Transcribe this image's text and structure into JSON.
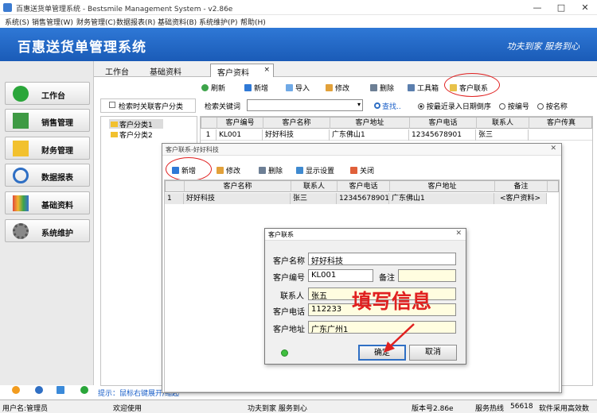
{
  "window": {
    "title": "百惠送货单管理系统 - Bestsmile Management System - v2.86e",
    "minimize": "—",
    "maximize": "□",
    "close": "✕"
  },
  "menu": [
    "系统(S)",
    "销售管理(W)",
    "财务管理(C)",
    "数据报表(R)",
    "基础资料(B)",
    "系统维护(P)",
    "帮助(H)"
  ],
  "banner": {
    "name": "百惠送货单管理系统",
    "slogan": "功夫到家 服务到心"
  },
  "sidebar": [
    "工作台",
    "销售管理",
    "财务管理",
    "数据报表",
    "基础资料",
    "系统维护"
  ],
  "tabs": [
    "工作台",
    "基础资料",
    "客户资料"
  ],
  "tab_close": "×",
  "toolbar": [
    "刷新",
    "新增",
    "导入",
    "修改",
    "删除",
    "工具箱",
    "客户联系"
  ],
  "filter": {
    "checkbox": "检索时关联客户分类",
    "keyword_label": "检索关键词",
    "search": "查找..",
    "sort1": "按最近录入日期倒序",
    "sort2": "按编号",
    "sort3": "按名称"
  },
  "tree": [
    "客户分类1",
    "客户分类2"
  ],
  "customer_table": {
    "headers": [
      "客户编号",
      "客户名称",
      "客户地址",
      "客户电话",
      "联系人",
      "客户传真"
    ],
    "rows": [
      {
        "n": "1",
        "cells": [
          "KL001",
          "好好科技",
          "广东佛山1",
          "12345678901",
          "张三",
          ""
        ]
      }
    ]
  },
  "contact_dialog": {
    "title": "客户联系-好好科技",
    "close": "✕",
    "toolbar": [
      "新增",
      "修改",
      "删除",
      "显示设置",
      "关闭"
    ],
    "headers": [
      "客户名称",
      "联系人",
      "客户电话",
      "客户地址",
      "备注"
    ],
    "rows": [
      {
        "n": "1",
        "cells": [
          "好好科技",
          "张三",
          "12345678901",
          "广东佛山1",
          "<客户资料>"
        ]
      }
    ]
  },
  "form_dialog": {
    "title": "客户联系",
    "close": "✕",
    "labels": {
      "name": "客户名称",
      "code": "客户编号",
      "remark": "备注",
      "contact": "联系人",
      "phone": "客户电话",
      "address": "客户地址"
    },
    "values": {
      "name": "好好科技",
      "code": "KL001",
      "remark": "",
      "contact": "张五",
      "phone": "112233",
      "address": "广东广州1"
    },
    "ok": "确定",
    "cancel": "取消"
  },
  "annotation": "填写信息",
  "hint": "提示：鼠标右键展开/缩起",
  "status": [
    "用户名:管理员",
    "欢迎使用",
    "功夫到家 服务到心",
    "版本号2.86e",
    "服务热线",
    "56618",
    "软件采用高效数"
  ],
  "colors": {
    "banner": "#1f66c4",
    "accent_red": "#e02020",
    "hint_blue": "#1a5fc8"
  }
}
